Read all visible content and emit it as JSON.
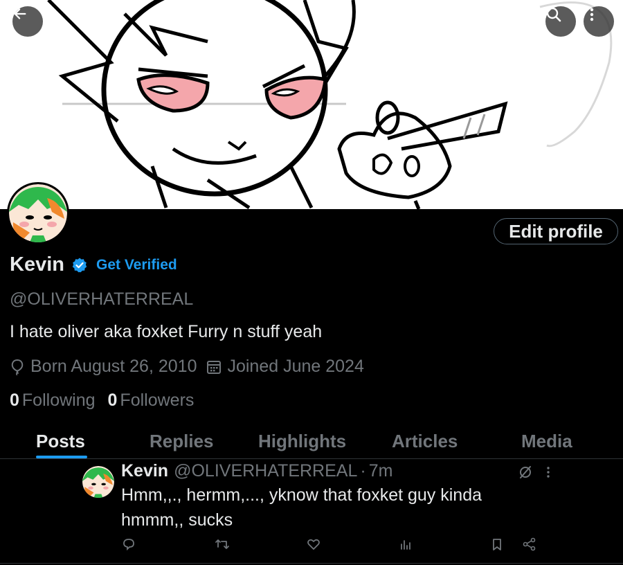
{
  "header": {
    "back_icon": "arrow-left-icon",
    "search_icon": "search-icon",
    "more_icon": "more-vertical-icon"
  },
  "profile": {
    "name": "Kevin",
    "verified_icon": "verified-badge-icon",
    "get_verified_label": "Get Verified",
    "handle": "@OLIVERHATERREAL",
    "bio": "I hate oliver aka foxket  Furry n stuff yeah",
    "birth_icon": "balloon-icon",
    "born": "Born August 26, 2010",
    "joined_icon": "calendar-icon",
    "joined": "Joined June 2024",
    "following_count": "0",
    "following_label": "Following",
    "followers_count": "0",
    "followers_label": "Followers",
    "edit_profile_label": "Edit profile"
  },
  "tabs": [
    {
      "label": "Posts",
      "active": true
    },
    {
      "label": "Replies",
      "active": false
    },
    {
      "label": "Highlights",
      "active": false
    },
    {
      "label": "Articles",
      "active": false
    },
    {
      "label": "Media",
      "active": false
    }
  ],
  "post": {
    "name": "Kevin",
    "handle": "@OLIVERHATERREAL",
    "separator": "·",
    "time": "7m",
    "text": "Hmm,,., hermm,..., yknow that foxket guy kinda hmmm,, sucks",
    "actions": [
      "reply-icon",
      "repost-icon",
      "like-icon",
      "views-icon",
      "bookmark-icon",
      "share-icon"
    ]
  },
  "colors": {
    "accent": "#1d9bf0",
    "background": "#000000",
    "text_primary": "#e7e9ea",
    "text_secondary": "#71767b"
  }
}
